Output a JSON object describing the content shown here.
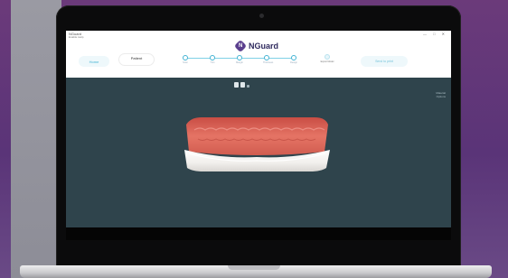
{
  "window": {
    "app_title": "NGuard",
    "menu": [
      "Enable",
      "Help"
    ],
    "controls": [
      "—",
      "□",
      "✕"
    ]
  },
  "header": {
    "logo_text": "NGuard",
    "logo_mark": "N",
    "left_button_label": "Home",
    "second_button_label": "Patient",
    "second_button_sub": "",
    "steps": [
      {
        "label": "Scan"
      },
      {
        "label": "Trim"
      },
      {
        "label": "Margin"
      },
      {
        "label": "Thickness"
      },
      {
        "label": "Design"
      }
    ],
    "last_step_label": "Export Model",
    "right_button_label": "Send to print"
  },
  "viewport": {
    "view_info_line1": "Material",
    "view_info_line2": "Options"
  },
  "colors": {
    "brand": "#5b3f8e",
    "accent": "#43b3d3",
    "viewport_bg": "#2f444c",
    "gum": "#e06a5a",
    "guard": "#f4f2ef"
  }
}
